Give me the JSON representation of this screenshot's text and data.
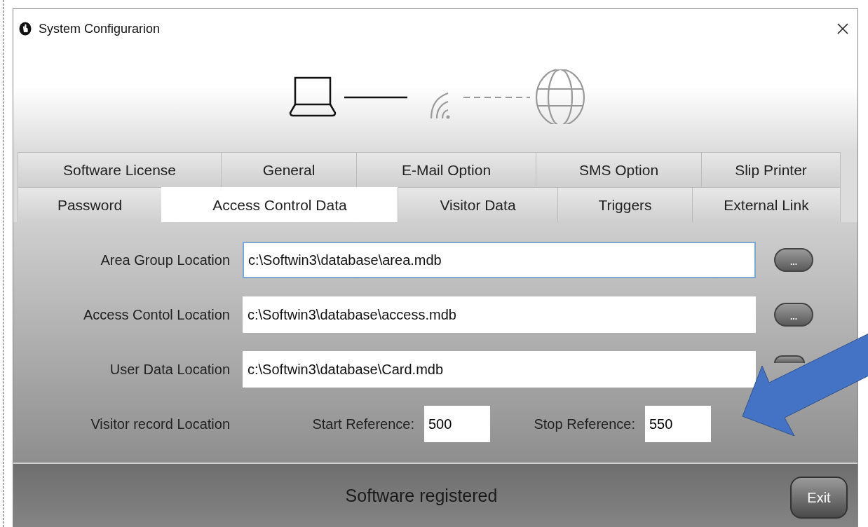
{
  "window": {
    "title": "System Configurarion"
  },
  "tab_rows": [
    {
      "tabs": [
        {
          "label": "Software License",
          "selected": false
        },
        {
          "label": "General",
          "selected": false
        },
        {
          "label": "E-Mail Option",
          "selected": false
        },
        {
          "label": "SMS Option",
          "selected": false
        },
        {
          "label": "Slip Printer",
          "selected": false
        }
      ]
    },
    {
      "tabs": [
        {
          "label": "Password",
          "selected": false
        },
        {
          "label": "Access Control Data",
          "selected": true
        },
        {
          "label": "Visitor Data",
          "selected": false
        },
        {
          "label": "Triggers",
          "selected": false
        },
        {
          "label": "External Link",
          "selected": false
        }
      ]
    }
  ],
  "fields": [
    {
      "label": "Area Group Location",
      "value": "c:\\Softwin3\\database\\area.mdb",
      "focused": true,
      "browse_label": "..."
    },
    {
      "label": "Access Contol Location",
      "value": "c:\\Softwin3\\database\\access.mdb",
      "focused": false,
      "browse_label": "..."
    },
    {
      "label": "User Data Location",
      "value": "c:\\Softwin3\\database\\Card.mdb",
      "focused": false
    }
  ],
  "visitor": {
    "label": "Visitor record Location",
    "start_label": "Start Reference:",
    "start_value": "500",
    "stop_label": "Stop Reference:",
    "stop_value": "550"
  },
  "status": "Software registered",
  "exit_button": "Exit"
}
